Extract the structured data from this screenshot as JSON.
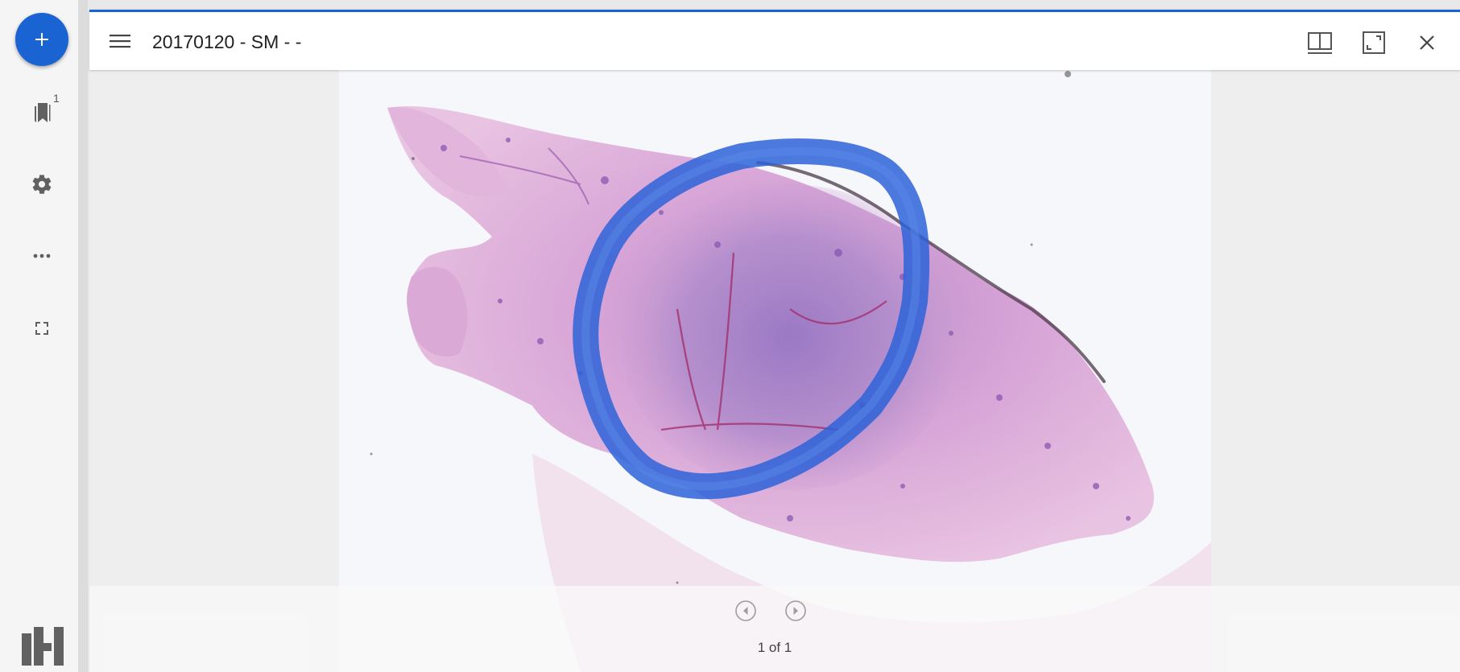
{
  "sidebar": {
    "add_button_icon": "plus-icon",
    "bookmarks_icon": "bookmarks-icon",
    "bookmarks_count": "1",
    "settings_icon": "gear-icon",
    "more_icon": "more-horizontal-icon",
    "fullscreen_icon": "fullscreen-icon",
    "logo_icon": "app-logo-icon"
  },
  "window": {
    "title": "20170120 - SM - -",
    "menu_icon": "hamburger-menu-icon",
    "split_icon": "split-view-icon",
    "maximize_icon": "maximize-icon",
    "close_icon": "close-icon"
  },
  "viewer": {
    "image_description_icon": "histology-slide-image",
    "prev_icon": "previous-circle-icon",
    "next_icon": "next-circle-icon",
    "page_indicator": "1 of 1"
  },
  "colors": {
    "accent": "#1a63d2",
    "tissue_pink": "#d9a6d6",
    "tissue_purple": "#9a6bb8",
    "marker_blue": "#2d63d8"
  }
}
